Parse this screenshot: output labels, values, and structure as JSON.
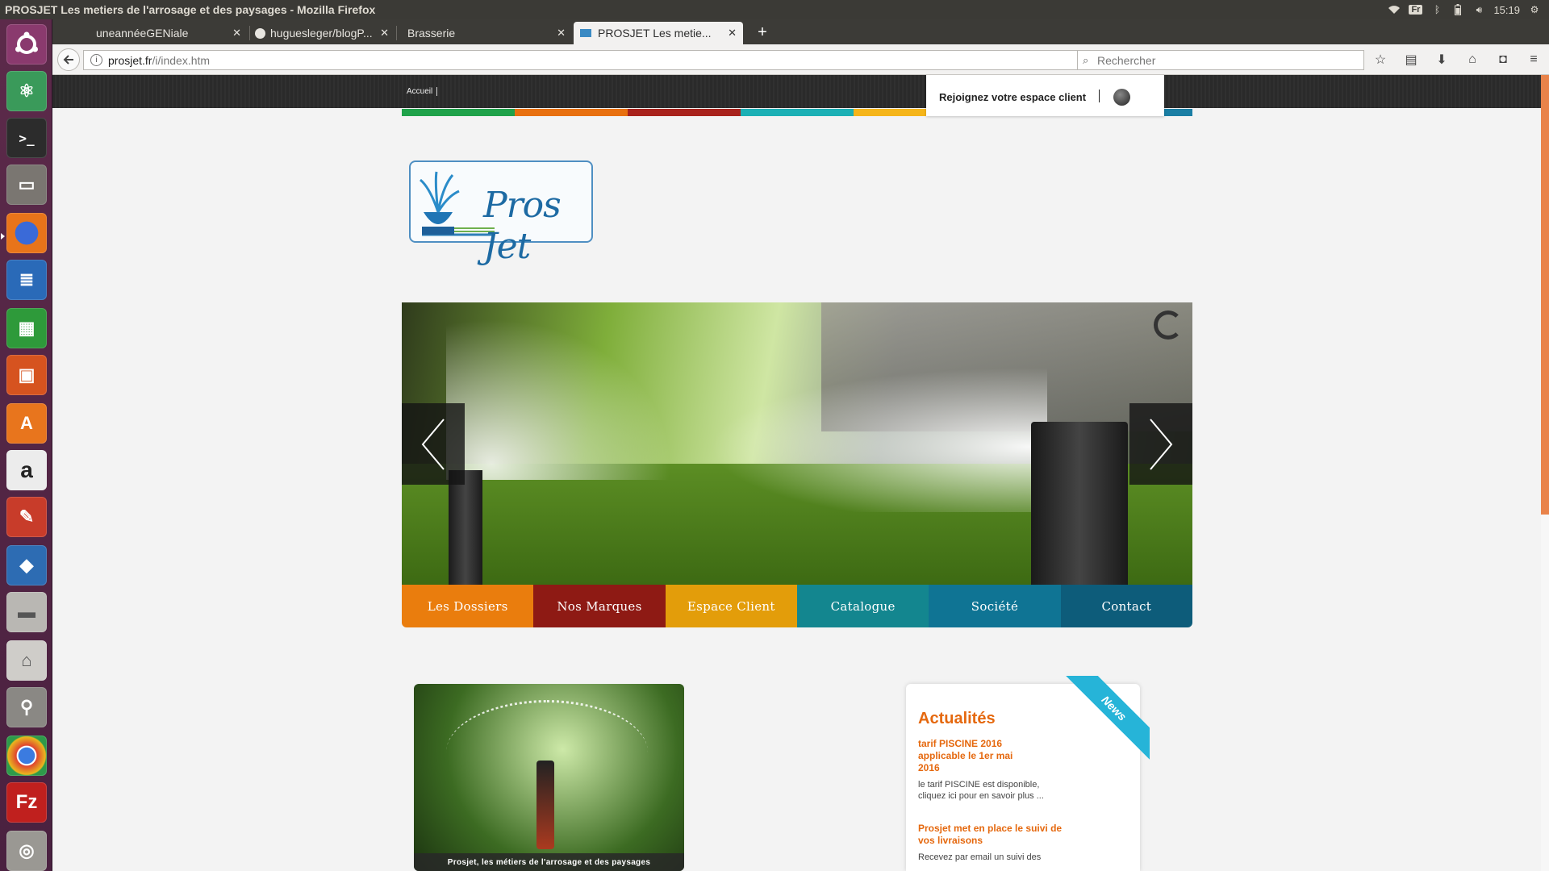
{
  "window": {
    "title": "PROSJET Les metiers de l'arrosage et des paysages - Mozilla Firefox"
  },
  "tray": {
    "keyboard": "Fr",
    "clock": "15:19"
  },
  "tabs": [
    {
      "label": "uneannéeGENiale"
    },
    {
      "label": "huguesleger/blogP..."
    },
    {
      "label": "Brasserie"
    },
    {
      "label": "PROSJET Les metie..."
    }
  ],
  "urlbar": {
    "host": "prosjet.fr",
    "path": "/i/index.htm"
  },
  "searchbar": {
    "placeholder": "Rechercher"
  },
  "site": {
    "home_link": "Accueil",
    "client_label": "Rejoignez votre espace client",
    "logo_text": "Pros Jet",
    "strip_colors": [
      "#1fa24a",
      "#e8700f",
      "#a8221c",
      "#1bb0b5",
      "#f5b51a",
      "#1a7ea4"
    ],
    "menu": [
      {
        "label": "Les Dossiers",
        "color": "#ea7d0d"
      },
      {
        "label": "Nos Marques",
        "color": "#8e1a14"
      },
      {
        "label": "Espace Client",
        "color": "#e39d0a"
      },
      {
        "label": "Catalogue",
        "color": "#13868f"
      },
      {
        "label": "Société",
        "color": "#0f7494"
      },
      {
        "label": "Contact",
        "color": "#0d5c7a"
      }
    ],
    "photo_caption": "Prosjet, les métiers de l'arrosage et des paysages",
    "news": {
      "ribbon": "News",
      "heading": "Actualités",
      "items": [
        {
          "title": "tarif PISCINE 2016 applicable le 1er mai 2016",
          "body": "le tarif PISCINE est disponible, cliquez ici pour en savoir plus ..."
        },
        {
          "title": "Prosjet met en place le suivi de vos livraisons",
          "body": "Recevez par email un suivi des"
        }
      ]
    }
  }
}
